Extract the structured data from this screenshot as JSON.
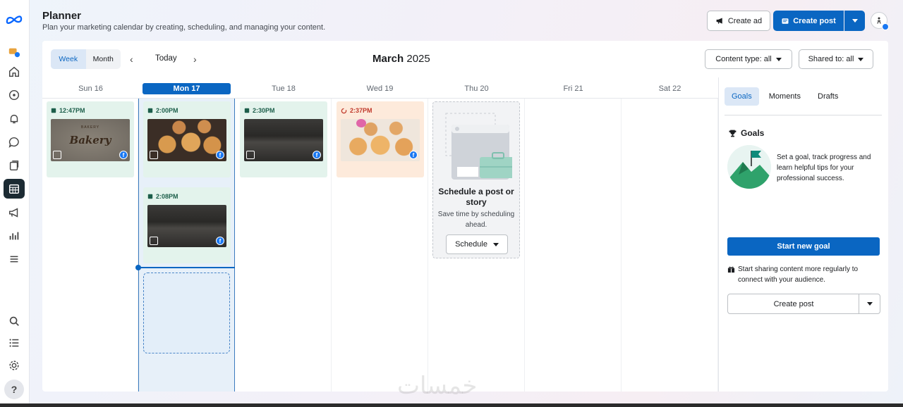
{
  "header": {
    "title": "Planner",
    "subtitle": "Plan your marketing calendar by creating, scheduling, and managing your content.",
    "create_ad": "Create ad",
    "create_post": "Create post"
  },
  "rail": {
    "items": [
      "meta-logo-icon",
      "notifications-icon",
      "home-icon",
      "compass-icon",
      "bell-icon",
      "chat-icon",
      "content-icon",
      "planner-icon",
      "ads-icon",
      "insights-icon",
      "menu-icon",
      "search-icon",
      "list-icon",
      "settings-icon",
      "help-icon"
    ],
    "help_label": "?"
  },
  "toolbar": {
    "views": [
      "Week",
      "Month"
    ],
    "active_view": "Week",
    "today": "Today",
    "month": "March",
    "year": "2025",
    "content_type": "Content type: all",
    "shared_to": "Shared to: all"
  },
  "calendar": {
    "days": [
      "Sun 16",
      "Mon 17",
      "Tue 18",
      "Wed 19",
      "Thu 20",
      "Fri 21",
      "Sat 22"
    ],
    "today_index": 1,
    "posts": [
      {
        "day": "Sun 16",
        "time": "12:47PM",
        "status": "scheduled",
        "thumb": "bakery-logo",
        "thumb_text": "Bakery",
        "thumb_small": "BAKERY"
      },
      {
        "day": "Mon 17",
        "time": "2:00PM",
        "status": "scheduled",
        "thumb": "cinnamon-buns"
      },
      {
        "day": "Mon 17",
        "time": "2:08PM",
        "status": "scheduled",
        "thumb": "dark-video"
      },
      {
        "day": "Tue 18",
        "time": "2:30PM",
        "status": "scheduled",
        "thumb": "dark-video"
      },
      {
        "day": "Wed 19",
        "time": "2:37PM",
        "status": "failed",
        "thumb": "cinnamon-buns-light"
      }
    ],
    "schedule_card": {
      "title": "Schedule a post or story",
      "body": "Save time by scheduling ahead.",
      "button": "Schedule"
    }
  },
  "right_panel": {
    "tabs": [
      "Goals",
      "Moments",
      "Drafts"
    ],
    "active_tab": "Goals",
    "goals_heading": "Goals",
    "goals_text": "Set a goal, track progress and learn helpful tips for your professional success.",
    "start_goal": "Start new goal",
    "share_text": "Start sharing content more regularly to connect with your audience.",
    "create_post": "Create post"
  },
  "watermark": "خمسات",
  "colors": {
    "accent": "#0a66c2",
    "scheduled_bg": "#e3f3ec",
    "failed_bg": "#fdeadb",
    "facebook": "#1877f2"
  }
}
